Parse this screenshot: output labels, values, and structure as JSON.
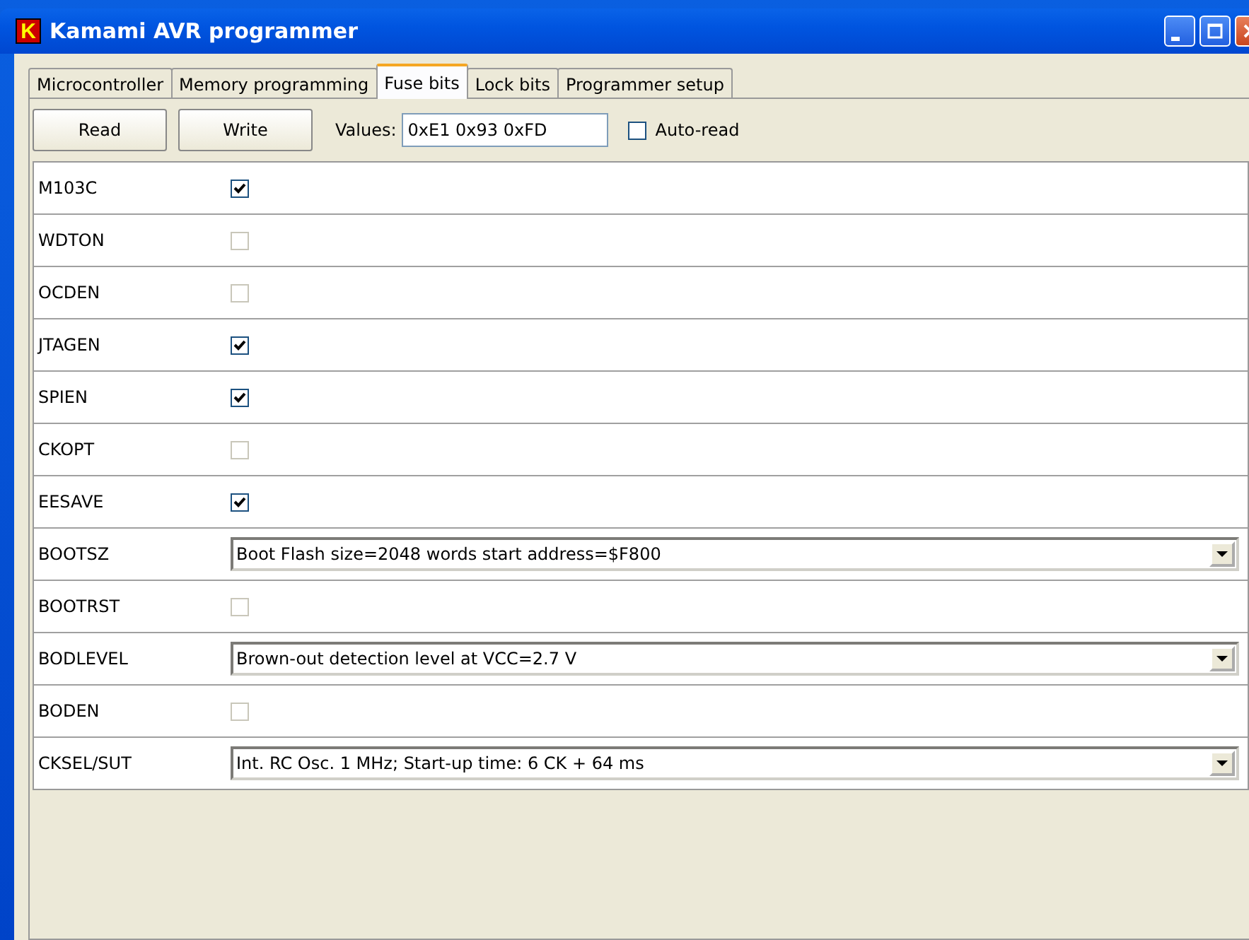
{
  "window": {
    "title": "Kamami AVR programmer",
    "logo": "K"
  },
  "tabs": [
    {
      "label": "Microcontroller",
      "selected": false
    },
    {
      "label": "Memory programming",
      "selected": false
    },
    {
      "label": "Fuse bits",
      "selected": true
    },
    {
      "label": "Lock bits",
      "selected": false
    },
    {
      "label": "Programmer setup",
      "selected": false
    }
  ],
  "toolbar": {
    "buttons": [
      "Read",
      "Write"
    ],
    "values_label": "Values:",
    "values": "0xE1 0x93 0xFD",
    "auto_read": {
      "label": "Auto-read",
      "checked": false
    }
  },
  "fuses": [
    {
      "name": "M103C",
      "kind": "checkbox",
      "checked": true
    },
    {
      "name": "WDTON",
      "kind": "checkbox",
      "checked": false
    },
    {
      "name": "OCDEN",
      "kind": "checkbox",
      "checked": false
    },
    {
      "name": "JTAGEN",
      "kind": "checkbox",
      "checked": true
    },
    {
      "name": "SPIEN",
      "kind": "checkbox",
      "checked": true
    },
    {
      "name": "CKOPT",
      "kind": "checkbox",
      "checked": false
    },
    {
      "name": "EESAVE",
      "kind": "checkbox",
      "checked": true
    },
    {
      "name": "BOOTSZ",
      "kind": "dropdown",
      "value": "Boot Flash size=2048 words start address=$F800"
    },
    {
      "name": "BOOTRST",
      "kind": "checkbox",
      "checked": false
    },
    {
      "name": "BODLEVEL",
      "kind": "dropdown",
      "value": "Brown-out detection level at VCC=2.7 V"
    },
    {
      "name": "BODEN",
      "kind": "checkbox",
      "checked": false
    },
    {
      "name": "CKSEL/SUT",
      "kind": "dropdown",
      "value": "Int. RC Osc. 1 MHz; Start-up time: 6 CK + 64 ms"
    }
  ]
}
